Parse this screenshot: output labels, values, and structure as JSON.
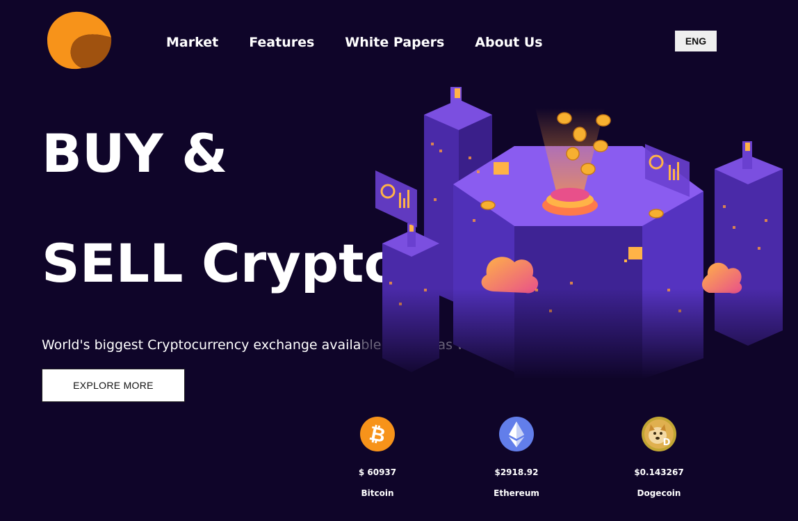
{
  "nav": {
    "items": [
      {
        "label": "Market"
      },
      {
        "label": "Features"
      },
      {
        "label": "White Papers"
      },
      {
        "label": "About Us"
      }
    ],
    "language": "ENG"
  },
  "brand": {
    "logo_icon": "crescent-logo-icon",
    "colors": {
      "orange": "#f7931a",
      "brown": "#a0520f"
    }
  },
  "hero": {
    "title_line1": "BUY &",
    "title_line2": "SELL Crypto",
    "subtitle": "World's biggest Cryptocurrency exchange available on web as well as mobile phone.",
    "cta": "EXPLORE MORE"
  },
  "coins": [
    {
      "name": "Bitcoin",
      "price": "$ 60937",
      "icon": "bitcoin-icon",
      "color": "#f7931a"
    },
    {
      "name": "Ethereum",
      "price": "$2918.92",
      "icon": "ethereum-icon",
      "color": "#627eea"
    },
    {
      "name": "Dogecoin",
      "price": "$0.143267",
      "icon": "dogecoin-icon",
      "color": "#c2a633"
    }
  ],
  "colors": {
    "background": "#0f0529",
    "accent_purple": "#7b4fe0"
  }
}
